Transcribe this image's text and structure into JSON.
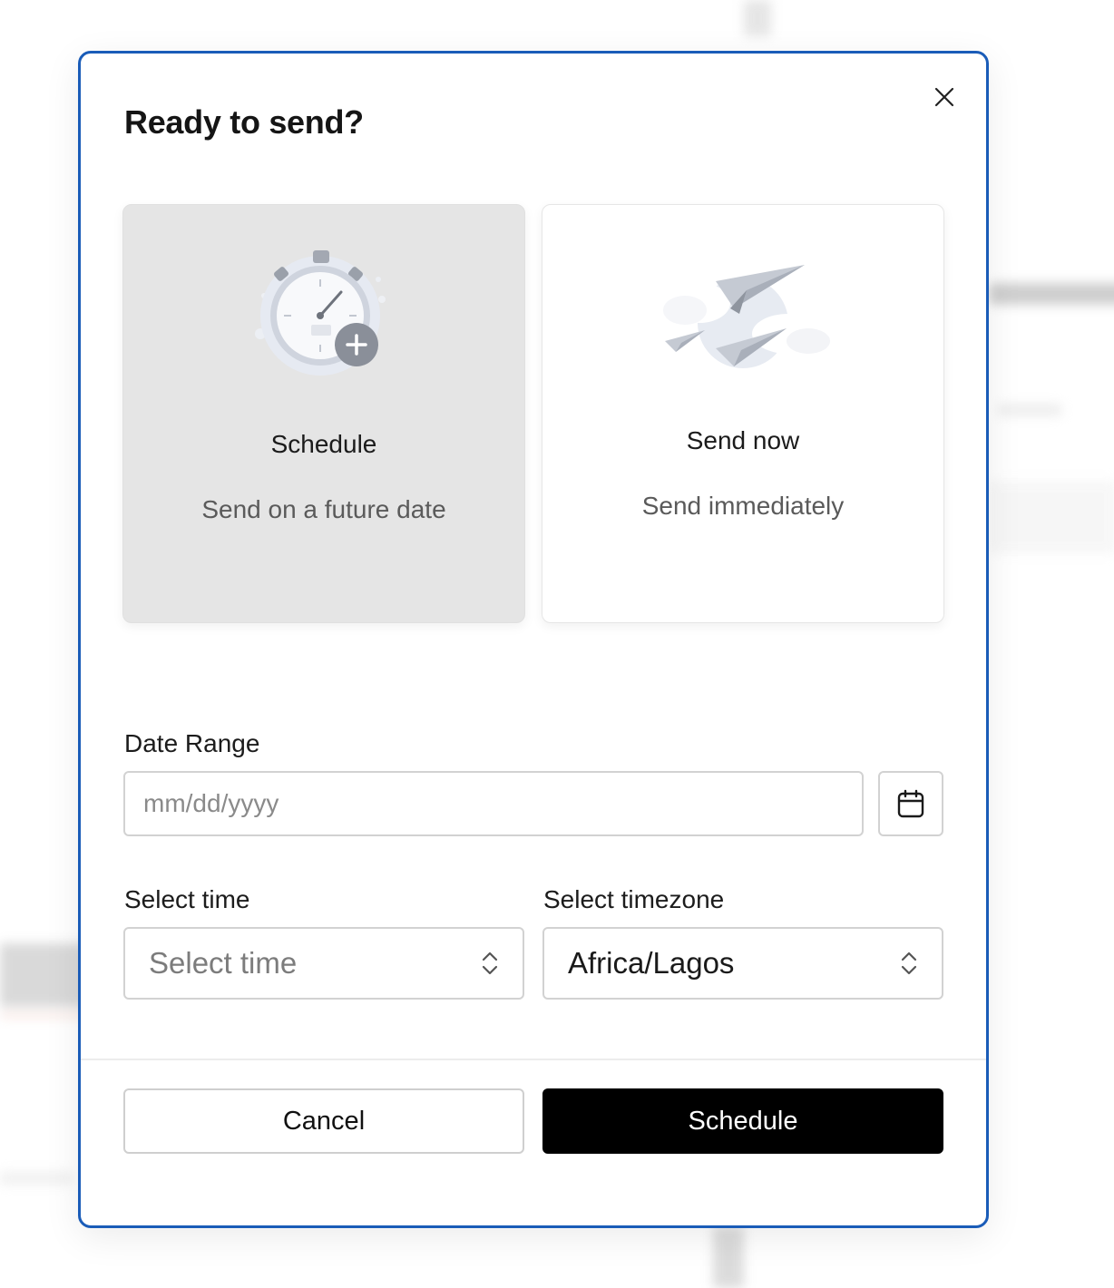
{
  "modal": {
    "title": "Ready to send?",
    "close_icon": "close-icon"
  },
  "options": [
    {
      "title": "Schedule",
      "subtitle": "Send on a future date",
      "selected": true,
      "icon": "stopwatch-plus-illustration"
    },
    {
      "title": "Send now",
      "subtitle": "Send immediately",
      "selected": false,
      "icon": "paper-planes-clouds-illustration"
    }
  ],
  "form": {
    "date_label": "Date Range",
    "date_placeholder": "mm/dd/yyyy",
    "date_value": "",
    "calendar_icon": "calendar-icon",
    "time_label": "Select time",
    "time_value": "Select time",
    "timezone_label": "Select timezone",
    "timezone_value": "Africa/Lagos"
  },
  "footer": {
    "cancel_label": "Cancel",
    "schedule_label": "Schedule"
  },
  "colors": {
    "modal_border": "#1a5cb8",
    "primary_button": "#000000",
    "selected_card": "#e5e5e5"
  }
}
